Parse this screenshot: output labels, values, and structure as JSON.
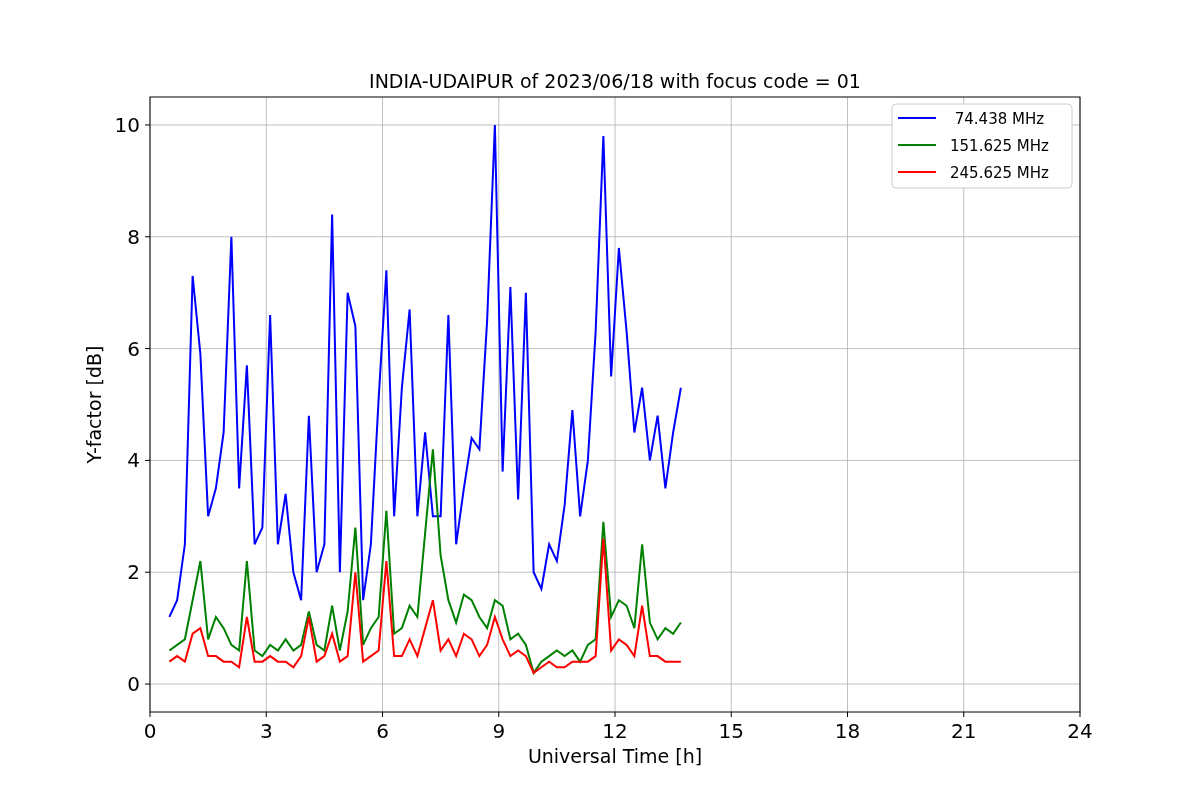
{
  "figure": {
    "chart_data": {
      "type": "line",
      "title": "INDIA-UDAIPUR of 2023/06/18 with focus code = 01",
      "xlabel": "Universal Time [h]",
      "ylabel": "Y-factor [dB]",
      "x": [
        0.5,
        0.7,
        0.9,
        1.1,
        1.3,
        1.5,
        1.7,
        1.9,
        2.1,
        2.3,
        2.5,
        2.7,
        2.9,
        3.1,
        3.3,
        3.5,
        3.7,
        3.9,
        4.1,
        4.3,
        4.5,
        4.7,
        4.9,
        5.1,
        5.3,
        5.5,
        5.7,
        5.9,
        6.1,
        6.3,
        6.5,
        6.7,
        6.9,
        7.1,
        7.3,
        7.5,
        7.7,
        7.9,
        8.1,
        8.3,
        8.5,
        8.7,
        8.9,
        9.1,
        9.3,
        9.5,
        9.7,
        9.9,
        10.1,
        10.3,
        10.5,
        10.7,
        10.9,
        11.1,
        11.3,
        11.5,
        11.7,
        11.9,
        12.1,
        12.3,
        12.5,
        12.7,
        12.9,
        13.1,
        13.3,
        13.5,
        13.7
      ],
      "series": [
        {
          "name": " 74.438 MHz",
          "color": "#0000ff",
          "values": [
            1.2,
            1.5,
            2.5,
            7.3,
            5.9,
            3,
            3.5,
            4.5,
            8.0,
            3.5,
            5.7,
            2.5,
            2.8,
            6.6,
            2.5,
            3.4,
            2,
            1.5,
            4.8,
            2,
            2.5,
            8.4,
            2,
            7.0,
            6.4,
            1.5,
            2.5,
            5.1,
            7.4,
            3,
            5.3,
            6.7,
            3,
            4.5,
            3,
            3,
            6.6,
            2.5,
            3.5,
            4.4,
            4.2,
            6.5,
            10.0,
            3.8,
            7.1,
            3.3,
            7.0,
            2,
            1.7,
            2.5,
            2.2,
            3.2,
            4.9,
            3,
            4,
            6.3,
            9.8,
            5.5,
            7.8,
            6.3,
            4.5,
            5.3,
            4,
            4.8,
            3.5,
            4.5,
            5.3
          ]
        },
        {
          "name": "151.625 MHz",
          "color": "#008000",
          "values": [
            0.6,
            0.7,
            0.8,
            1.5,
            2.2,
            0.8,
            1.2,
            1.0,
            0.7,
            0.6,
            2.2,
            0.6,
            0.5,
            0.7,
            0.6,
            0.8,
            0.6,
            0.7,
            1.3,
            0.7,
            0.6,
            1.4,
            0.6,
            1.3,
            2.8,
            0.7,
            1.0,
            1.2,
            3.1,
            0.9,
            1.0,
            1.4,
            1.2,
            2.7,
            4.2,
            2.3,
            1.5,
            1.1,
            1.6,
            1.5,
            1.2,
            1.0,
            1.5,
            1.4,
            0.8,
            0.9,
            0.7,
            0.2,
            0.4,
            0.5,
            0.6,
            0.5,
            0.6,
            0.4,
            0.7,
            0.8,
            2.9,
            1.2,
            1.5,
            1.4,
            1.0,
            2.5,
            1.1,
            0.8,
            1.0,
            0.9,
            1.1
          ]
        },
        {
          "name": "245.625 MHz",
          "color": "#ff0000",
          "values": [
            0.4,
            0.5,
            0.4,
            0.9,
            1.0,
            0.5,
            0.5,
            0.4,
            0.4,
            0.3,
            1.2,
            0.4,
            0.4,
            0.5,
            0.4,
            0.4,
            0.3,
            0.5,
            1.2,
            0.4,
            0.5,
            0.9,
            0.4,
            0.5,
            2.0,
            0.4,
            0.5,
            0.6,
            2.2,
            0.5,
            0.5,
            0.8,
            0.5,
            1.0,
            1.5,
            0.6,
            0.8,
            0.5,
            0.9,
            0.8,
            0.5,
            0.7,
            1.2,
            0.8,
            0.5,
            0.6,
            0.5,
            0.2,
            0.3,
            0.4,
            0.3,
            0.3,
            0.4,
            0.4,
            0.4,
            0.5,
            2.6,
            0.6,
            0.8,
            0.7,
            0.5,
            1.4,
            0.5,
            0.5,
            0.4,
            0.4,
            0.4
          ]
        }
      ],
      "grid": true,
      "legend": "upper right",
      "xlim": [
        0,
        24
      ],
      "ylim": [
        -0.5,
        10.5
      ],
      "xticks": [
        0,
        3,
        6,
        9,
        12,
        15,
        18,
        21,
        24
      ],
      "yticks": [
        0,
        2,
        4,
        6,
        8,
        10
      ]
    }
  }
}
